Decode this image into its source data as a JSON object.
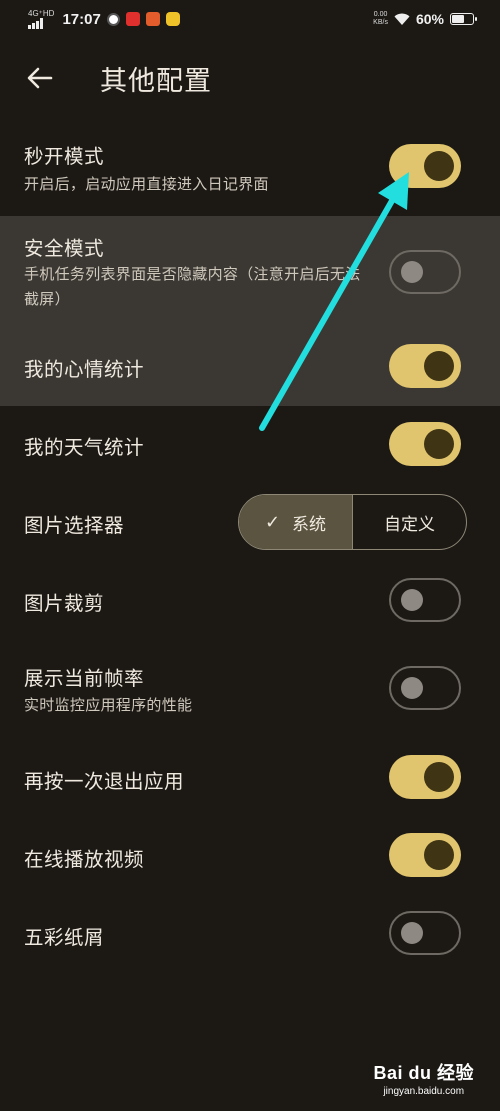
{
  "status_bar": {
    "network": "4G⁺HD",
    "time": "17:07",
    "speed_value": "0.00",
    "speed_unit": "KB/s",
    "battery": "60%",
    "battery_level": 0.6,
    "icons": [
      "signal-icon",
      "app-icon-1",
      "app-icon-2",
      "app-icon-3",
      "wifi-icon",
      "battery-icon"
    ]
  },
  "header": {
    "title": "其他配置",
    "back_icon": "arrow-left-icon"
  },
  "settings": {
    "quick_open": {
      "label": "秒开模式",
      "desc": "开启后，启动应用直接进入日记界面",
      "on": true
    },
    "safe_mode": {
      "label": "安全模式",
      "desc": "手机任务列表界面是否隐藏内容（注意开启后无法截屏）",
      "on": false
    },
    "mood_stats": {
      "label": "我的心情统计",
      "on": true
    },
    "weather_stats": {
      "label": "我的天气统计",
      "on": true
    },
    "image_picker": {
      "label": "图片选择器",
      "options": [
        "系统",
        "自定义"
      ],
      "selected": "系统"
    },
    "image_crop": {
      "label": "图片裁剪",
      "on": false
    },
    "frame_rate": {
      "label": "展示当前帧率",
      "desc": "实时监控应用程序的性能",
      "on": false
    },
    "press_again_exit": {
      "label": "再按一次退出应用",
      "on": true
    },
    "online_video": {
      "label": "在线播放视频",
      "on": true
    },
    "confetti": {
      "label": "五彩纸屑",
      "on": false
    }
  },
  "colors": {
    "background": "#1c1915",
    "highlight": "#3b3833",
    "toggle_on": "#e1c56e",
    "knob_on": "#3f3514",
    "annotation_arrow": "#22dede"
  },
  "watermark": {
    "main": "Bai du 经验",
    "sub": "jingyan.baidu.com"
  }
}
